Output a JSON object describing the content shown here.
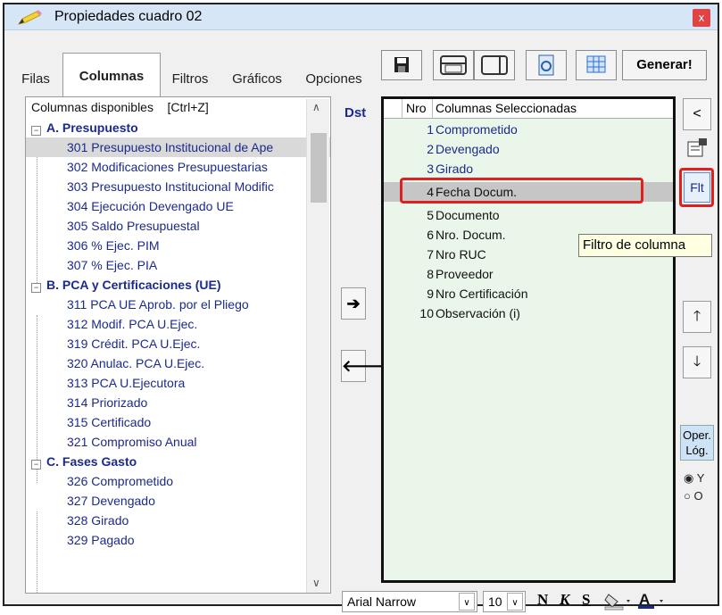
{
  "window": {
    "title": "Propiedades cuadro 02",
    "close": "x"
  },
  "tabs": [
    "Filas",
    "Columnas",
    "Filtros",
    "Gráficos",
    "Opciones"
  ],
  "toolbar": {
    "generar": "Generar!"
  },
  "left": {
    "header": "Columnas disponibles",
    "shortcut": "[Ctrl+Z]",
    "groups": [
      {
        "label": "A. Presupuesto",
        "items": [
          "301 Presupuesto Institucional de Ape",
          "302 Modificaciones Presupuestarias",
          "303 Presupuesto Institucional Modific",
          "304 Ejecución Devengado UE",
          "305 Saldo Presupuestal",
          "306 % Ejec. PIM",
          "307 % Ejec. PIA"
        ]
      },
      {
        "label": "B. PCA y Certificaciones (UE)",
        "items": [
          "311 PCA UE Aprob. por el Pliego",
          "312 Modif. PCA U.Ejec.",
          "319 Crédit. PCA U.Ejec.",
          "320 Anulac. PCA U.Ejec.",
          "313 PCA U.Ejecutora",
          "314 Priorizado",
          "315 Certificado",
          "321 Compromiso Anual"
        ]
      },
      {
        "label": "C. Fases Gasto",
        "items": [
          "326 Comprometido",
          "327 Devengado",
          "328 Girado",
          "329 Pagado"
        ]
      }
    ]
  },
  "middle": {
    "dst": "Dst",
    "right_arrow": "➔",
    "left_arrow": "🡐"
  },
  "right": {
    "col_nro": "Nro",
    "col_name": "Columnas Seleccionadas",
    "rows": [
      {
        "n": "1",
        "t": "Comprometido"
      },
      {
        "n": "2",
        "t": "Devengado"
      },
      {
        "n": "3",
        "t": "Girado"
      },
      {
        "n": "4",
        "t": "Fecha Docum."
      },
      {
        "n": "5",
        "t": "Documento"
      },
      {
        "n": "6",
        "t": "Nro. Docum."
      },
      {
        "n": "7",
        "t": "Nro RUC"
      },
      {
        "n": "8",
        "t": "Proveedor"
      },
      {
        "n": "9",
        "t": "Nro Certificación"
      },
      {
        "n": "10",
        "t": "Observación (i)"
      }
    ]
  },
  "side": {
    "back": "<",
    "flt": "Flt",
    "tooltip": "Filtro de columna",
    "up": "🡑",
    "down": "🡓",
    "oper_line1": "Oper.",
    "oper_line2": "Lóg.",
    "radio_y": "Y",
    "radio_o": "O"
  },
  "fontbar": {
    "font": "Arial Narrow",
    "size": "10",
    "bold": "N",
    "italic": "K",
    "strike": "S"
  },
  "colors": {
    "accent_blue": "#1b2a8c",
    "highlight_red": "#e0201e",
    "selected_bg": "#eaf6ea"
  }
}
